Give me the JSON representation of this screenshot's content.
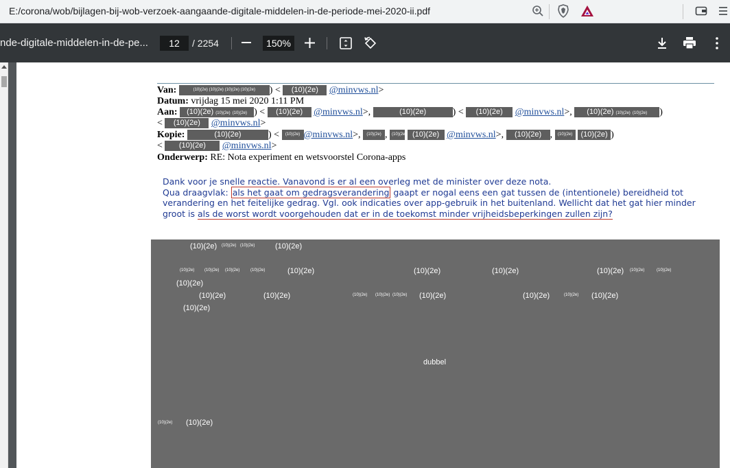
{
  "browser": {
    "url": "E:/corona/wob/bijlagen-bij-wob-verzoek-aangaande-digitale-middelen-in-de-periode-mei-2020-ii.pdf"
  },
  "toolbar": {
    "title": "nde-digitale-middelen-in-de-pe...",
    "page_current": "12",
    "page_total": "/ 2254",
    "zoom": "150%"
  },
  "email": {
    "van_label": "Van:",
    "datum_label": "Datum:",
    "datum_value": "vrijdag 15 mei 2020 1:11 PM",
    "aan_label": "Aan:",
    "kopie_label": "Kopie:",
    "onderwerp_label": "Onderwerp:",
    "onderwerp_value": "RE: Nota experiment en wetsvoorstel Corona-apps",
    "domain": "@minvws.nl",
    "redact": "(10)(2e)",
    "redact_small": "(10)(2e)",
    "lt": "<",
    "gt": ">",
    "gt_comma": ">,",
    "paren_close": ")",
    "paren_open_lt": ") <",
    "comma": ","
  },
  "body": {
    "line1": "Dank voor je snelle reactie. Vanavond is er al een overleg met de minister over deze nota.",
    "line2_a": "Qua draagvlak: ",
    "line2_boxed": "als het gaat om gedragsverandering",
    "line2_b": " gaapt er nogal eens een gat tussen de (intentionele) bereidheid tot",
    "line3": "verandering en het feitelijke gedrag. Vgl. ook indicaties over app-gebruik in het buitenland. Wellicht dat het gat hier minder",
    "line4_a": "groot is ",
    "line4_underlined": "als de worst wordt voorgehouden dat er in de toekomst minder vrijheidsbeperkingen zullen zijn?"
  },
  "redaction_block": {
    "code": "(10)(2e)",
    "code_small": "(10)(2e)",
    "center_label": "dubbel"
  }
}
